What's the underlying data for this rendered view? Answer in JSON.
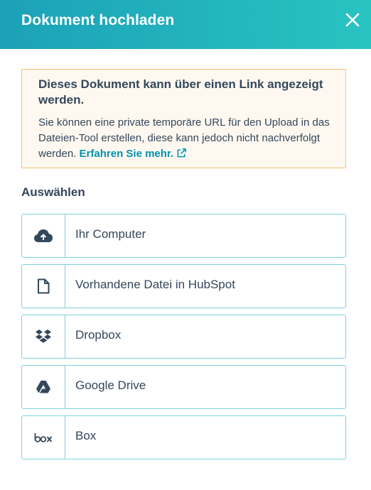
{
  "modal": {
    "title": "Dokument hochladen",
    "close_icon": "close-icon"
  },
  "alert": {
    "title": "Dieses Dokument kann über einen Link angezeigt werden.",
    "body": "Sie können eine private temporäre URL für den Upload in das Dateien-Tool erstellen, diese kann jedoch nicht nachverfolgt werden.",
    "link_label": "Erfahren Sie mehr.",
    "link_icon": "external-link-icon"
  },
  "section": {
    "label": "Auswählen"
  },
  "options": [
    {
      "label": "Ihr Computer",
      "icon": "cloud-upload-icon"
    },
    {
      "label": "Vorhandene Datei in HubSpot",
      "icon": "file-icon"
    },
    {
      "label": "Dropbox",
      "icon": "dropbox-icon"
    },
    {
      "label": "Google Drive",
      "icon": "google-drive-icon"
    },
    {
      "label": "Box",
      "icon": "box-icon"
    }
  ],
  "colors": {
    "header_gradient_start": "#1ca1b8",
    "header_gradient_end": "#28c4c0",
    "link": "#0091ae",
    "alert_border": "#f5c26b",
    "alert_background": "#fef8f0",
    "option_border": "#7fd1de",
    "text": "#33475b"
  }
}
